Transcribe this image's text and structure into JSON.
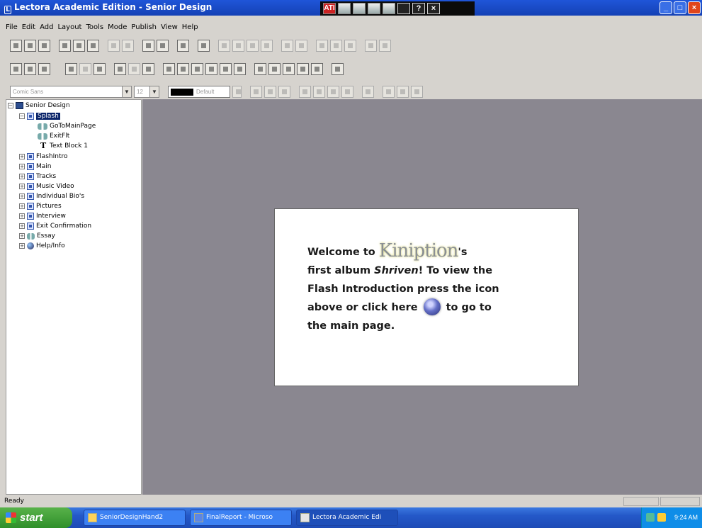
{
  "window": {
    "title": "Lectora Academic Edition - Senior Design",
    "controls": [
      "_",
      "□",
      "×"
    ]
  },
  "floating_toolbar": {
    "buttons": [
      "ATI",
      "",
      "",
      "",
      "",
      "",
      "?",
      "×"
    ]
  },
  "menu": {
    "items": [
      "File",
      "Edit",
      "Add",
      "Layout",
      "Tools",
      "Mode",
      "Publish",
      "View",
      "Help"
    ]
  },
  "toolbar3": {
    "font_name": "Comic Sans",
    "font_size": "12",
    "color_label": "Default"
  },
  "tree": {
    "root": "Senior Design",
    "selected": "Splash",
    "children_of_splash": [
      "GoToMainPage",
      "ExitFlt",
      "Text Block 1"
    ],
    "pages": [
      "FlashIntro",
      "Main",
      "Tracks",
      "Music Video",
      "Individual Bio's",
      "Pictures",
      "Interview",
      "Exit Confirmation",
      "Essay",
      "Help/Info"
    ]
  },
  "slide": {
    "welcome": "Welcome to",
    "brand": "Kiniption",
    "brand_suffix": "'s",
    "line2_a": "first album",
    "album": "Shriven",
    "line2_b": "! To view the",
    "line3": "Flash Introduction press the icon",
    "line4_a": "above or click here",
    "line4_b": "to go to",
    "line5": "the main page."
  },
  "status": {
    "text": "Ready"
  },
  "taskbar": {
    "start_label": "start",
    "tasks": [
      "SeniorDesignHand2",
      "FinalReport - Microso",
      "Lectora Academic Edi"
    ],
    "clock": "9:24 AM"
  }
}
